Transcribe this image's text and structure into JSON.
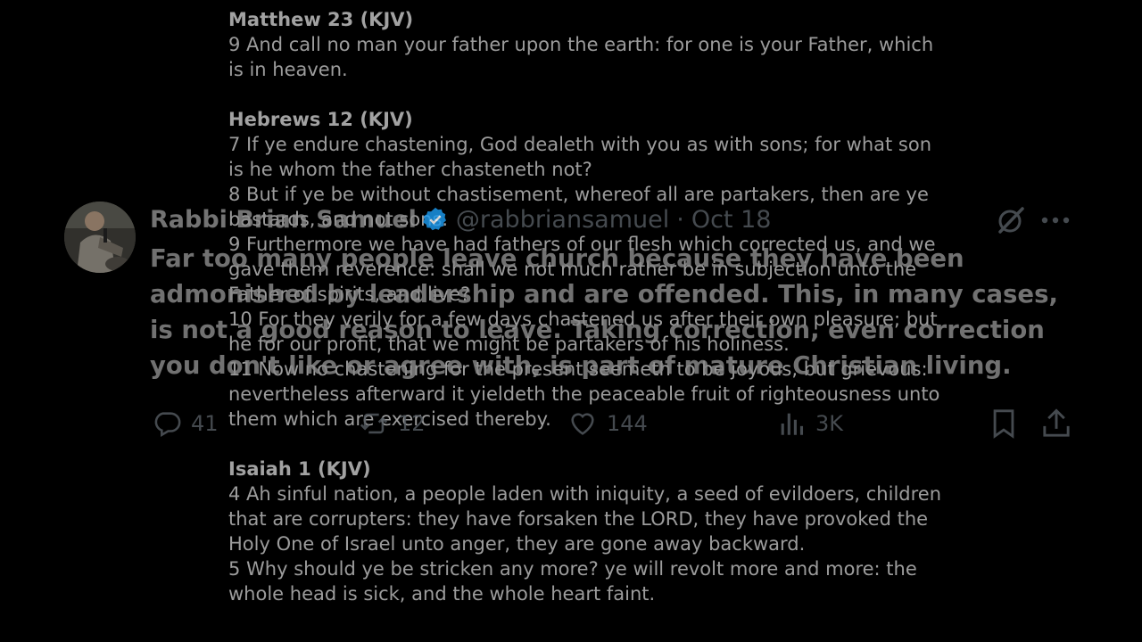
{
  "scripture": {
    "passages": [
      {
        "reference": "Matthew 23 (KJV)",
        "verses": [
          "9 And call no man your father upon the earth: for one is your Father, which is in heaven."
        ]
      },
      {
        "reference": "Hebrews 12 (KJV)",
        "verses": [
          "7 If ye endure chastening, God dealeth with you as with sons; for what son is he whom the father chasteneth not?",
          "8 But if ye be without chastisement, whereof all are partakers, then are ye bastards, and not sons.",
          "9 Furthermore we have had fathers of our flesh which corrected us, and we gave them reverence: shall we not much rather be in subjection unto the Father of spirits, and live?",
          "10 For they verily for a few days chastened us after their own pleasure; but he for our profit, that we might be partakers of his holiness.",
          "11 Now no chastening for the present seemeth to be joyous, but grievous: nevertheless afterward it yieldeth the peaceable fruit of righteousness unto them which are exercised thereby."
        ]
      },
      {
        "reference": "Isaiah 1 (KJV)",
        "verses": [
          "4 Ah sinful nation, a people laden with iniquity, a seed of evildoers, children that are corrupters: they have forsaken the LORD, they have provoked the Holy One of Israel unto anger, they are gone away backward.",
          "5 Why should ye be stricken any more? ye will revolt more and more: the whole head is sick, and the whole heart faint."
        ]
      }
    ]
  },
  "tweet": {
    "author_name": "Rabbi Brian Samuel",
    "handle": "@rabbriansamuel",
    "separator": "·",
    "date": "Oct 18",
    "text": "Far too many people leave church because they have been admonished by leadership and are offended. This, in many cases, is not a good reason to leave. Taking correction, even correction you don't like or agree with, is part of mature Christian living.",
    "stats": {
      "replies": "41",
      "reposts": "12",
      "likes": "144",
      "views": "3K"
    }
  },
  "colors": {
    "background": "#000000",
    "verified_badge": "#1d9bf0",
    "muted": "#555b61"
  },
  "icons": [
    "verified-icon",
    "grok-icon",
    "more-icon",
    "reply-icon",
    "repost-icon",
    "like-icon",
    "views-icon",
    "bookmark-icon",
    "share-icon"
  ]
}
